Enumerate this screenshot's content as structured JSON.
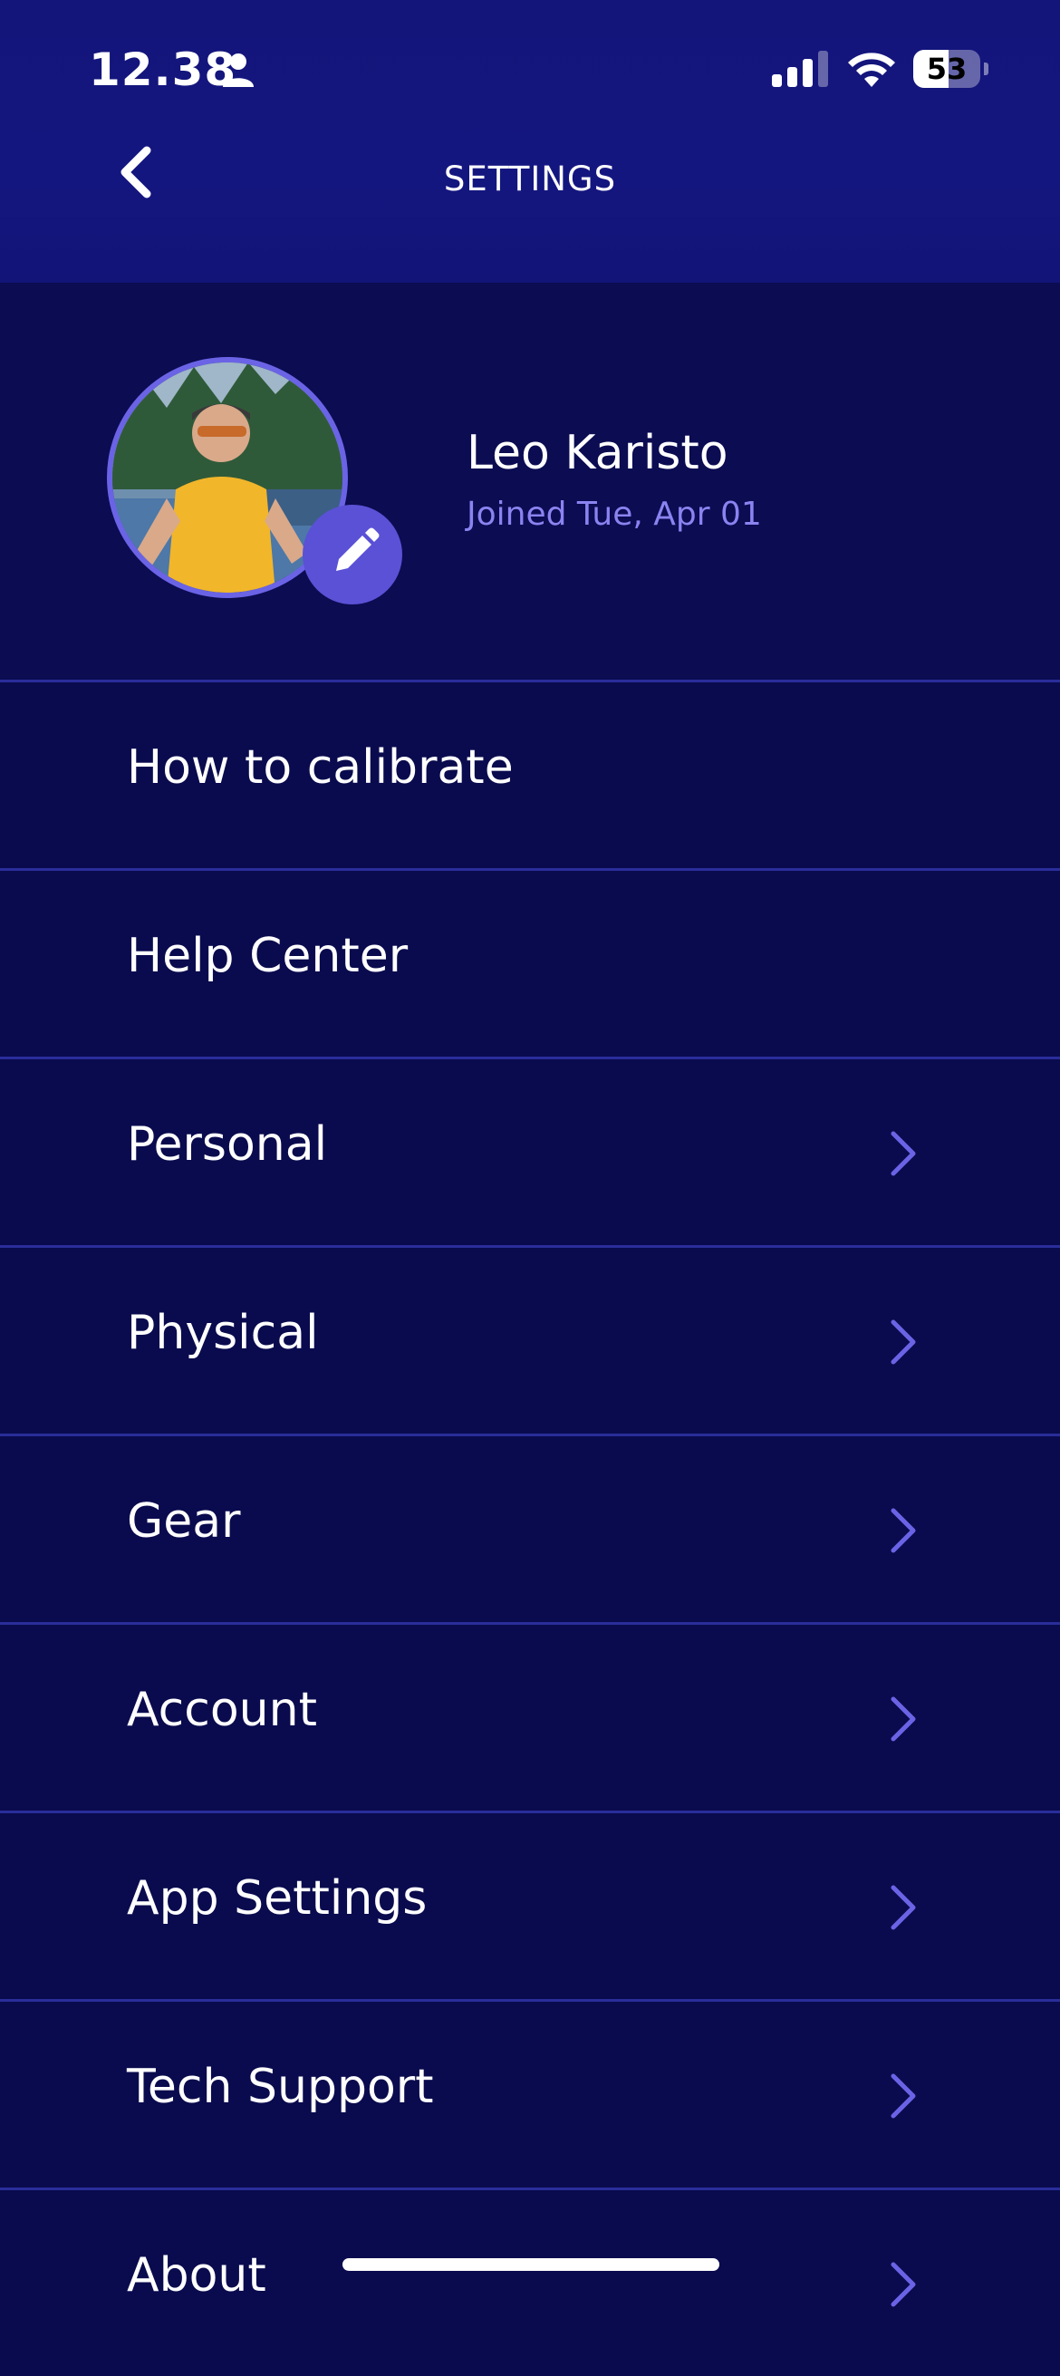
{
  "status_bar": {
    "time": "12.38",
    "battery": "53",
    "battery_level": 0.53
  },
  "header": {
    "title": "SETTINGS"
  },
  "profile": {
    "name": "Leo Karisto",
    "joined": "Joined Tue, Apr 01"
  },
  "menu": {
    "items": [
      {
        "label": "How to calibrate",
        "chevron": false
      },
      {
        "label": "Help Center",
        "chevron": false
      },
      {
        "label": "Personal",
        "chevron": true
      },
      {
        "label": "Physical",
        "chevron": true
      },
      {
        "label": "Gear",
        "chevron": true
      },
      {
        "label": "Account",
        "chevron": true
      },
      {
        "label": "App Settings",
        "chevron": true
      },
      {
        "label": "Tech Support",
        "chevron": true
      },
      {
        "label": "About",
        "chevron": true
      }
    ]
  },
  "colors": {
    "background": "#0a0b4e",
    "header": "#141680",
    "accent": "#6b63e6",
    "divider": "#2a2d9a",
    "joined_text": "#8b83f0"
  },
  "icons": {
    "back": "chevron-left-icon",
    "edit": "pencil-icon",
    "row": "chevron-right-icon"
  }
}
